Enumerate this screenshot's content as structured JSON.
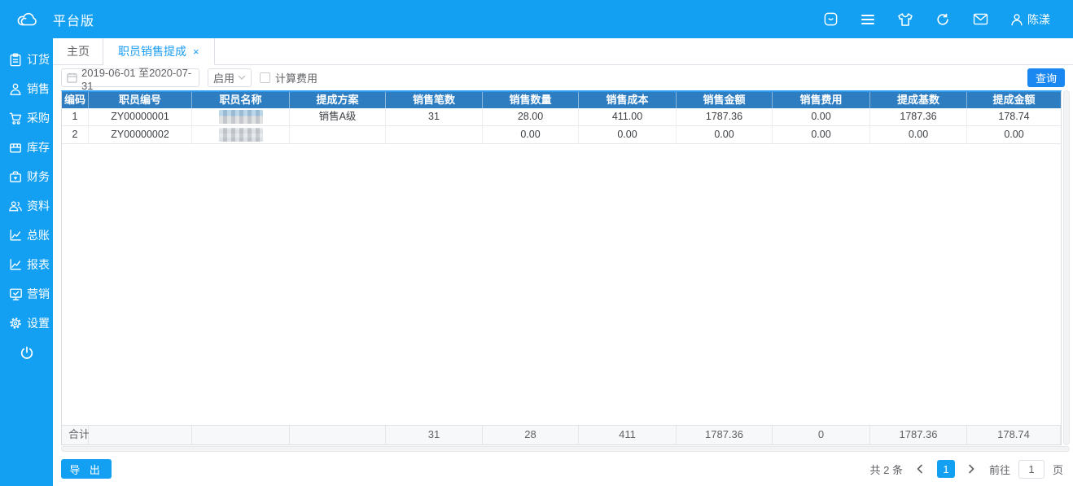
{
  "topbar": {
    "title": "平台版",
    "user": "陈漾"
  },
  "sidebar": {
    "items": [
      {
        "label": "订货"
      },
      {
        "label": "销售"
      },
      {
        "label": "采购"
      },
      {
        "label": "库存"
      },
      {
        "label": "财务"
      },
      {
        "label": "资料"
      },
      {
        "label": "总账"
      },
      {
        "label": "报表"
      },
      {
        "label": "营销"
      },
      {
        "label": "设置"
      }
    ]
  },
  "tabs": {
    "home": "主页",
    "current": "职员销售提成",
    "close": "×"
  },
  "filters": {
    "date_range": "2019-06-01 至2020-07-31",
    "status_select": "启用",
    "checkbox_label": "计算费用",
    "query_button": "查询"
  },
  "table": {
    "columns": [
      "编码",
      "职员编号",
      "职员名称",
      "提成方案",
      "销售笔数",
      "销售数量",
      "销售成本",
      "销售金额",
      "销售费用",
      "提成基数",
      "提成金额"
    ],
    "rows": [
      {
        "cells": [
          "1",
          "ZY00000001",
          "",
          "销售A级",
          "31",
          "28.00",
          "411.00",
          "1787.36",
          "0.00",
          "1787.36",
          "178.74"
        ],
        "name_blurred": true
      },
      {
        "cells": [
          "2",
          "ZY00000002",
          "",
          "",
          "",
          "0.00",
          "0.00",
          "0.00",
          "0.00",
          "0.00",
          "0.00"
        ],
        "name_blurred": true
      }
    ],
    "total_cells": [
      "合计",
      "",
      "",
      "",
      "31",
      "28",
      "411",
      "1787.36",
      "0",
      "1787.36",
      "178.74"
    ]
  },
  "footer": {
    "export_button": "导 出",
    "total_count": "共 2 条",
    "active_page": "1",
    "goto_label": "前往",
    "goto_value": "1",
    "page_suffix": "页"
  }
}
